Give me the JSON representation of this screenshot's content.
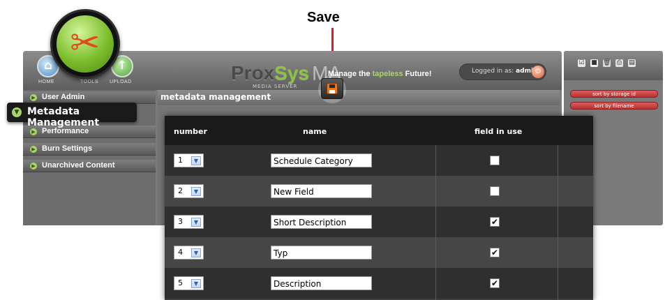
{
  "callout": {
    "label": "Save"
  },
  "header": {
    "nav": [
      {
        "label": "HOME",
        "icon": "home-icon"
      },
      {
        "label": "TOOLS",
        "icon": "tools-icon"
      },
      {
        "label": "UPLOAD",
        "icon": "upload-icon"
      }
    ],
    "logo": {
      "prox": "Prox",
      "sys": "Sys",
      "ma": "MA",
      "sub": "MEDIA SERVER"
    },
    "tagline_prefix": "Manage the ",
    "tagline_em": "tapeless",
    "tagline_suffix": " Future!",
    "login_prefix": "Logged in as: ",
    "login_user": "admin"
  },
  "sidebar": {
    "items": [
      {
        "label": "User Admin"
      },
      {
        "label": "Metadata Management"
      },
      {
        "label": "Performance"
      },
      {
        "label": "Burn Settings"
      },
      {
        "label": "Unarchived Content"
      }
    ]
  },
  "content": {
    "title": "metadata management"
  },
  "right_panel": {
    "sort_buttons": [
      "sort by storage id",
      "sort by filename"
    ]
  },
  "table": {
    "headers": {
      "number": "number",
      "name": "name",
      "field_in_use": "field in use"
    },
    "rows": [
      {
        "number": "1",
        "name": "Schedule Category",
        "in_use": false
      },
      {
        "number": "2",
        "name": "New Field",
        "in_use": false
      },
      {
        "number": "3",
        "name": "Short Description",
        "in_use": true
      },
      {
        "number": "4",
        "name": "Typ",
        "in_use": true
      },
      {
        "number": "5",
        "name": "Description",
        "in_use": true
      }
    ]
  },
  "colors": {
    "accent_green": "#a8d66a",
    "sort_button_red": "#c94545",
    "callout_red": "#e01818"
  }
}
